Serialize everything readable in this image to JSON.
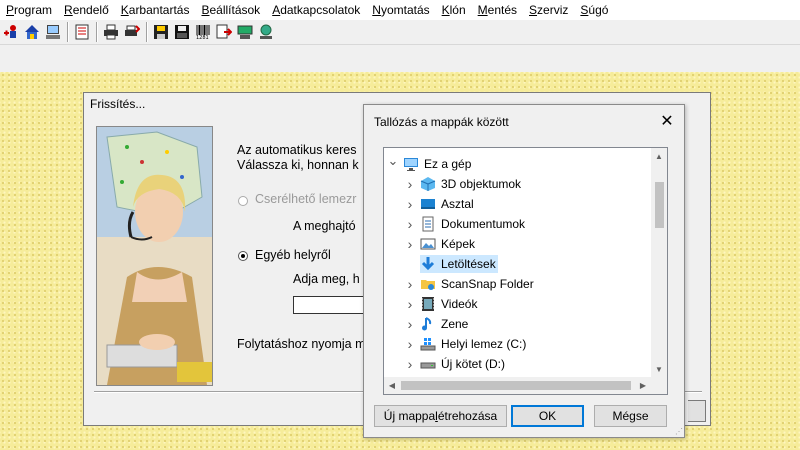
{
  "menu": [
    {
      "label": "Program",
      "accel": "P",
      "rest": "rogram"
    },
    {
      "label": "Rendelő",
      "accel": "R",
      "rest": "endelő"
    },
    {
      "label": "Karbantartás",
      "accel": "K",
      "rest": "arbantartás"
    },
    {
      "label": "Beállítások",
      "accel": "B",
      "rest": "eállítások"
    },
    {
      "label": "Adatkapcsolatok",
      "accel": "A",
      "rest": "datkapcsolatok"
    },
    {
      "label": "Nyomtatás",
      "accel": "N",
      "rest": "yomtatás"
    },
    {
      "label": "Klón",
      "accel": "K",
      "rest": "lón"
    },
    {
      "label": "Mentés",
      "accel": "M",
      "rest": "entés"
    },
    {
      "label": "Szerviz",
      "accel": "S",
      "rest": "zerviz"
    },
    {
      "label": "Súgó",
      "accel": "S",
      "rest": "úgó"
    }
  ],
  "toolbar_icons": [
    "person-add-icon",
    "home-icon",
    "computer-icon",
    "document-icon",
    "printer-icon",
    "print-queue-icon",
    "save-icon",
    "floppy-icon",
    "barcode-icon",
    "import-icon",
    "device-icon",
    "network-icon"
  ],
  "update_dialog": {
    "title": "Frissítés...",
    "intro_line1": "Az automatikus keres",
    "intro_line2": "Válassza ki, honnan k",
    "option_removable": "Cserélhető lemezr",
    "drive_label": "A meghajtó",
    "option_other": "Egyéb helyről",
    "path_prompt": "Adja meg, h",
    "continue_text": "Folytatáshoz nyomja m"
  },
  "browse_dialog": {
    "title": "Tallózás a mappák között",
    "close": "✕",
    "tree": [
      {
        "label": "Ez a gép",
        "icon": "pc-icon",
        "expanded": true,
        "level": 0
      },
      {
        "label": "3D objektumok",
        "icon": "3d-objects-icon",
        "level": 1
      },
      {
        "label": "Asztal",
        "icon": "desktop-icon",
        "level": 1
      },
      {
        "label": "Dokumentumok",
        "icon": "documents-icon",
        "level": 1
      },
      {
        "label": "Képek",
        "icon": "pictures-icon",
        "level": 1
      },
      {
        "label": "Letöltések",
        "icon": "downloads-icon",
        "level": 1,
        "selected": true
      },
      {
        "label": "ScanSnap Folder",
        "icon": "scansnap-folder-icon",
        "level": 1
      },
      {
        "label": "Videók",
        "icon": "videos-icon",
        "level": 1
      },
      {
        "label": "Zene",
        "icon": "music-icon",
        "level": 1
      },
      {
        "label": "Helyi lemez (C:)",
        "icon": "windows-drive-icon",
        "level": 1
      },
      {
        "label": "Új kötet (D:)",
        "icon": "drive-icon",
        "level": 1
      }
    ],
    "new_folder_button": "Új mappa létrehozása",
    "ok_button": "OK",
    "cancel_button": "Mégse"
  },
  "colors": {
    "workspace": "#f6ec9a",
    "selection": "#cce8ff",
    "accent": "#0078d7"
  }
}
